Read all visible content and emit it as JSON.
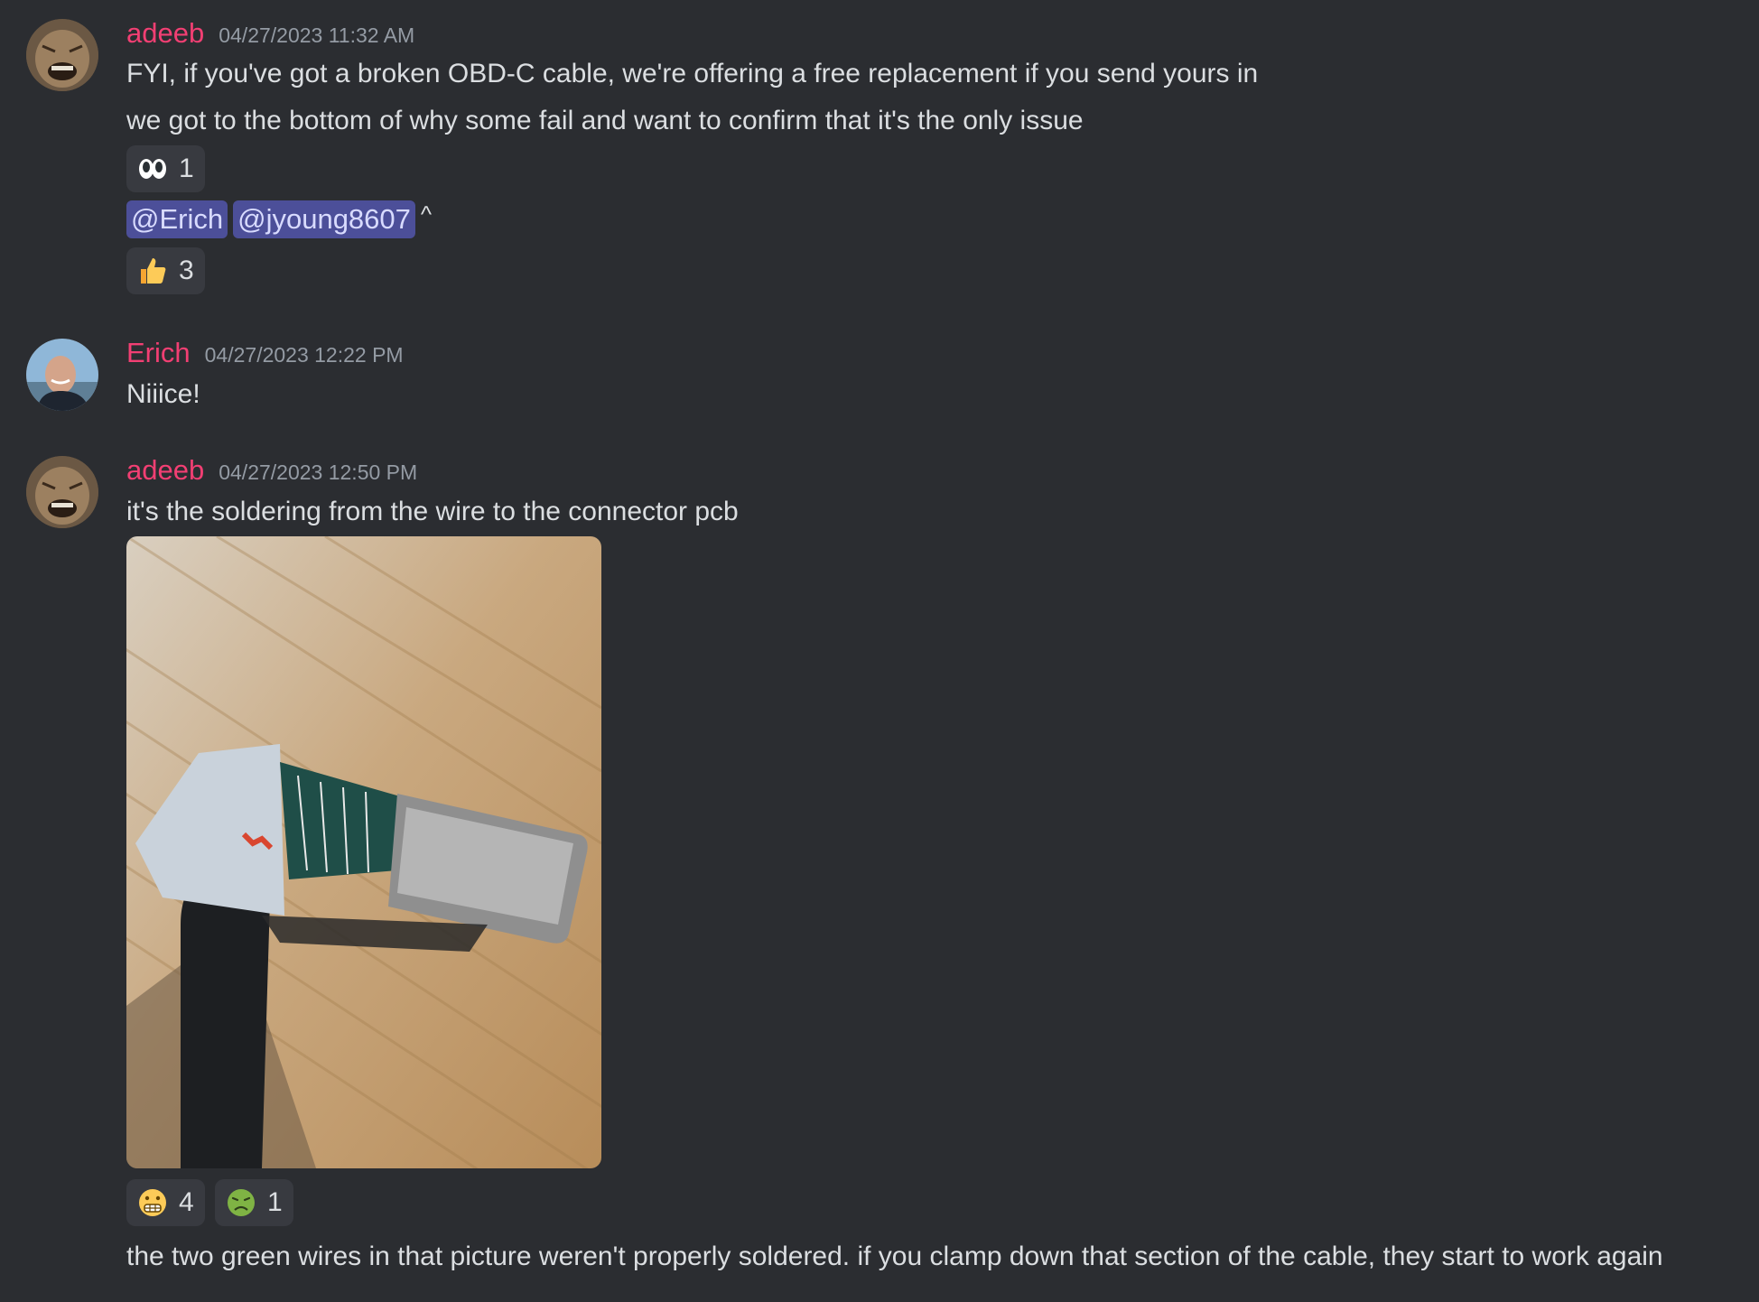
{
  "messages": [
    {
      "username": "adeeb",
      "timestamp": "04/27/2023 11:32 AM",
      "lines": [
        "FYI, if you've got a broken OBD-C cable, we're offering a free replacement if you send yours in",
        "we got to the bottom of why some fail and want to confirm that it's the only issue"
      ],
      "reaction1": {
        "emoji": "eyes-icon",
        "count": "1"
      },
      "mentions": [
        "@Erich",
        "@jyoung8607"
      ],
      "mention_suffix": "^",
      "reaction2": {
        "emoji": "thumbs-up-icon",
        "count": "3"
      }
    },
    {
      "username": "Erich",
      "timestamp": "04/27/2023 12:22 PM",
      "lines": [
        "Niiice!"
      ]
    },
    {
      "username": "adeeb",
      "timestamp": "04/27/2023 12:50 PM",
      "lines": [
        "it's the soldering from the wire to the connector pcb",
        "the two green wires in that picture weren't properly soldered. if you clamp down that section of the cable, they start to work again"
      ],
      "attachment": {
        "type": "photo"
      },
      "reactions": [
        {
          "emoji": "grimacing-face-icon",
          "count": "4"
        },
        {
          "emoji": "nauseated-face-icon",
          "count": "1"
        }
      ]
    }
  ],
  "colors": {
    "background": "#2b2d31",
    "username": "#f23f73",
    "timestamp": "#949ba4",
    "text": "#dbdee1",
    "reaction_bg": "#383a40",
    "mention_bg": "#4c4f99",
    "mention_text": "#d8dbff"
  }
}
